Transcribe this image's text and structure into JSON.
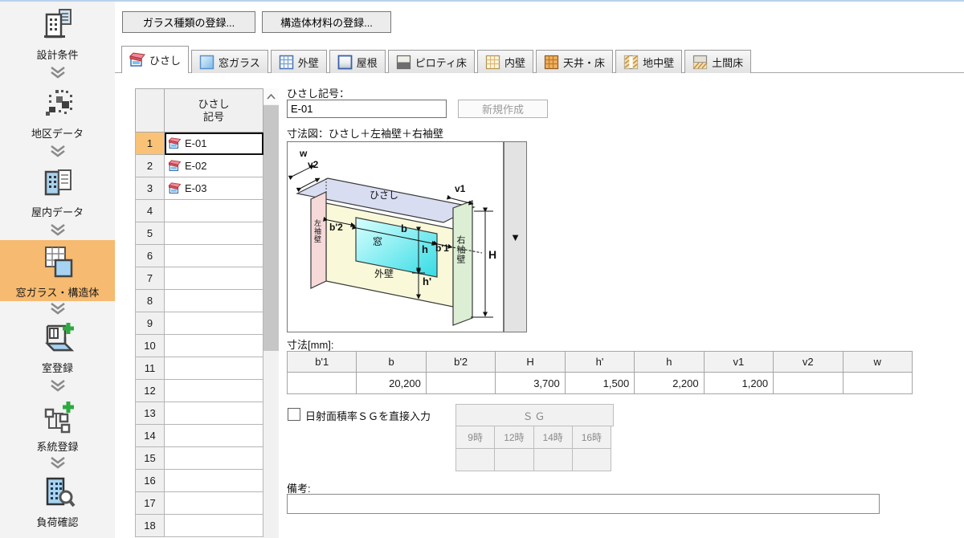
{
  "sidebar": {
    "items": [
      {
        "label": "設計条件",
        "icon": "design-conditions"
      },
      {
        "label": "地区データ",
        "icon": "district-data"
      },
      {
        "label": "屋内データ",
        "icon": "indoor-data"
      },
      {
        "label": "窓ガラス・構造体",
        "icon": "window-structure",
        "active": true
      },
      {
        "label": "室登録",
        "icon": "room-register"
      },
      {
        "label": "系統登録",
        "icon": "system-register"
      },
      {
        "label": "負荷確認",
        "icon": "load-check"
      }
    ]
  },
  "toolbar": {
    "glass_button": "ガラス種類の登録...",
    "material_button": "構造体材料の登録..."
  },
  "tabs": [
    {
      "label": "ひさし",
      "active": true
    },
    {
      "label": "窓ガラス"
    },
    {
      "label": "外壁"
    },
    {
      "label": "屋根"
    },
    {
      "label": "ピロティ床"
    },
    {
      "label": "内壁"
    },
    {
      "label": "天井・床"
    },
    {
      "label": "地中壁"
    },
    {
      "label": "土間床"
    }
  ],
  "list": {
    "header_line1": "ひさし",
    "header_line2": "記号",
    "rows": [
      {
        "num": "1",
        "value": "E-01",
        "selected": true
      },
      {
        "num": "2",
        "value": "E-02"
      },
      {
        "num": "3",
        "value": "E-03"
      },
      {
        "num": "4",
        "value": ""
      },
      {
        "num": "5",
        "value": ""
      },
      {
        "num": "6",
        "value": ""
      },
      {
        "num": "7",
        "value": ""
      },
      {
        "num": "8",
        "value": ""
      },
      {
        "num": "9",
        "value": ""
      },
      {
        "num": "10",
        "value": ""
      },
      {
        "num": "11",
        "value": ""
      },
      {
        "num": "12",
        "value": ""
      },
      {
        "num": "13",
        "value": ""
      },
      {
        "num": "14",
        "value": ""
      },
      {
        "num": "15",
        "value": ""
      },
      {
        "num": "16",
        "value": ""
      },
      {
        "num": "17",
        "value": ""
      },
      {
        "num": "18",
        "value": ""
      }
    ]
  },
  "form": {
    "symbol_label": "ひさし記号：",
    "symbol_value": "E-01",
    "new_button": "新規作成",
    "diagram_label": "寸法図：ひさし＋左袖壁＋右袖壁",
    "diagram_selector": "▼",
    "diagram": {
      "w": "w",
      "v2": "v2",
      "v1": "v1",
      "hisashi": "ひさし",
      "left_wall": "左袖壁",
      "right_wall": "右袖壁",
      "window": "窓",
      "wall": "外壁",
      "b2": "b'2",
      "b": "b",
      "b1": "b'1",
      "h": "h",
      "h_prime": "h'",
      "H": "H"
    },
    "dims": {
      "title": "寸法[mm]:",
      "headers": [
        "b'1",
        "b",
        "b'2",
        "H",
        "h'",
        "h",
        "v1",
        "v2",
        "w"
      ],
      "values": [
        "",
        "20,200",
        "",
        "3,700",
        "1,500",
        "2,200",
        "1,200",
        "",
        ""
      ]
    },
    "sg": {
      "checkbox_label": "日射面積率ＳＧを直接入力",
      "table_title": "ＳＧ",
      "times": [
        "9時",
        "12時",
        "14時",
        "16時"
      ],
      "values": [
        "",
        "",
        "",
        ""
      ]
    },
    "remarks_label": "備考:",
    "remarks_value": ""
  },
  "colors": {
    "accent_orange": "#f6ba70",
    "selected_row": "#f9c277",
    "awning_fill": "#d8ddf1",
    "left_wall_fill": "#f6d9d9",
    "right_wall_fill": "#dcefd5",
    "wall_fill": "#f9f9da",
    "window_fill": "#52dce6"
  }
}
